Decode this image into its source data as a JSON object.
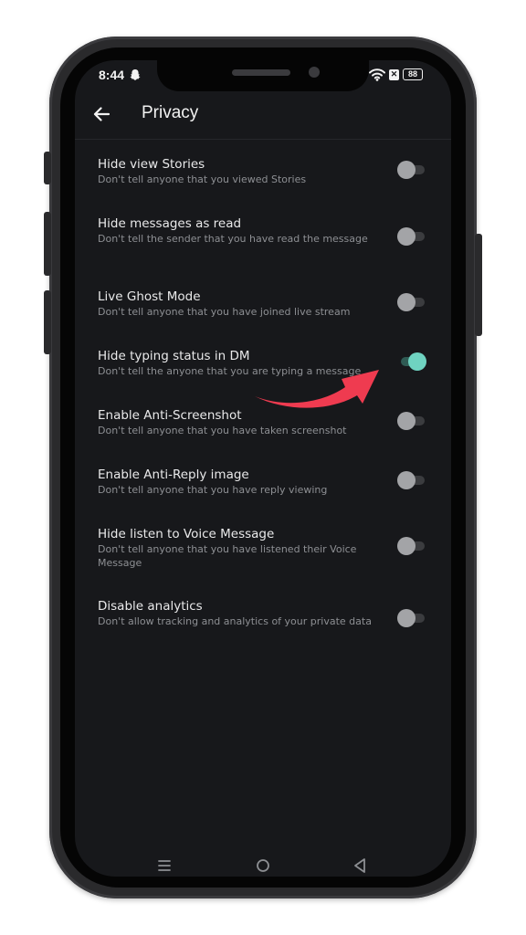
{
  "status_bar": {
    "time": "8:44",
    "battery": "88"
  },
  "header": {
    "title": "Privacy"
  },
  "settings": [
    {
      "title": "Hide view Stories",
      "description": "Don't tell anyone that you viewed Stories",
      "enabled": false
    },
    {
      "title": "Hide messages as read",
      "description": "Don't tell the sender that you have read the message",
      "enabled": false
    },
    {
      "title": "Live Ghost Mode",
      "description": "Don't tell anyone that you have joined live stream",
      "enabled": false
    },
    {
      "title": "Hide typing status in DM",
      "description": "Don't tell the anyone that you are typing a message",
      "enabled": true
    },
    {
      "title": "Enable Anti-Screenshot",
      "description": "Don't tell anyone that you have taken screenshot",
      "enabled": false
    },
    {
      "title": "Enable Anti-Reply image",
      "description": "Don't tell anyone that you have reply viewing",
      "enabled": false
    },
    {
      "title": "Hide listen to Voice Message",
      "description": "Don't tell anyone that you have listened their Voice Message",
      "enabled": false
    },
    {
      "title": "Disable analytics",
      "description": "Don't allow tracking and analytics of your private data",
      "enabled": false
    }
  ],
  "colors": {
    "background": "#17181b",
    "toggle_on": "#6fd3c1",
    "toggle_off": "#a3a4a7",
    "annotation_arrow": "#ef3b50"
  },
  "icons": {
    "status": [
      "snapchat-ghost-icon",
      "wifi-icon",
      "x-notification-icon",
      "battery-icon"
    ],
    "header": "arrow-left-icon",
    "navigation": [
      "menu-icon",
      "home-circle-icon",
      "back-triangle-icon"
    ]
  }
}
